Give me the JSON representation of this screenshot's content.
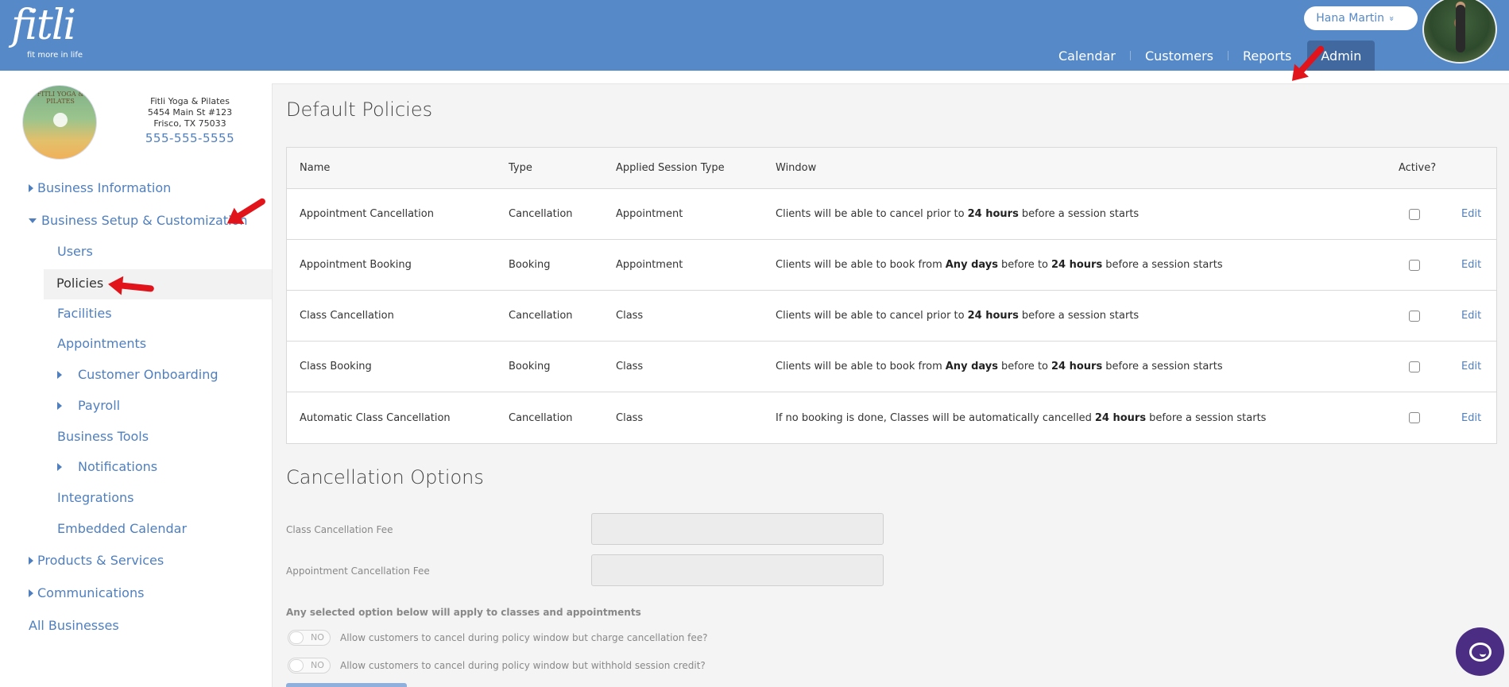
{
  "header": {
    "logo_word": "fitli",
    "logo_tagline": "fit more in life",
    "user_name": "Hana Martin",
    "user_chevron": "»",
    "nav": [
      "Calendar",
      "Customers",
      "Reports",
      "Admin"
    ],
    "active_nav": "Admin"
  },
  "sidebar": {
    "biz_logo_text": "FITLI YOGA & PILATES",
    "biz_name": "Fitli Yoga & Pilates",
    "biz_address1": "5454 Main St #123",
    "biz_address2": "Frisco, TX 75033",
    "biz_phone": "555-555-5555",
    "items": {
      "business_information": "Business Information",
      "business_setup": "Business Setup & Customization",
      "users": "Users",
      "policies": "Policies",
      "facilities": "Facilities",
      "appointments": "Appointments",
      "customer_onboarding": "Customer Onboarding",
      "payroll": "Payroll",
      "business_tools": "Business Tools",
      "notifications": "Notifications",
      "integrations": "Integrations",
      "embedded_calendar": "Embedded Calendar",
      "products_services": "Products & Services",
      "communications": "Communications",
      "all_businesses": "All Businesses"
    }
  },
  "main": {
    "default_policies_title": "Default Policies",
    "table": {
      "headers": {
        "name": "Name",
        "type": "Type",
        "session": "Applied Session Type",
        "window": "Window",
        "active": "Active?"
      },
      "rows": [
        {
          "name": "Appointment Cancellation",
          "type": "Cancellation",
          "session": "Appointment",
          "w1": "Clients will be able to cancel prior to",
          "b1": "24 hours",
          "w2": "before a session starts",
          "b2": "",
          "w3": "",
          "edit": "Edit"
        },
        {
          "name": "Appointment Booking",
          "type": "Booking",
          "session": "Appointment",
          "w1": "Clients will be able to book from",
          "b1": "Any days",
          "w2": "before to",
          "b2": "24 hours",
          "w3": "before a session starts",
          "edit": "Edit"
        },
        {
          "name": "Class Cancellation",
          "type": "Cancellation",
          "session": "Class",
          "w1": "Clients will be able to cancel prior to",
          "b1": "24 hours",
          "w2": "before a session starts",
          "b2": "",
          "w3": "",
          "edit": "Edit"
        },
        {
          "name": "Class Booking",
          "type": "Booking",
          "session": "Class",
          "w1": "Clients will be able to book from",
          "b1": "Any days",
          "w2": "before to",
          "b2": "24 hours",
          "w3": "before a session starts",
          "edit": "Edit"
        },
        {
          "name": "Automatic Class Cancellation",
          "type": "Cancellation",
          "session": "Class",
          "w1": "If no booking is done, Classes will be automatically cancelled",
          "b1": "24 hours",
          "w2": "before a session starts",
          "b2": "",
          "w3": "",
          "edit": "Edit"
        }
      ]
    },
    "cancellation_title": "Cancellation Options",
    "class_fee_label": "Class Cancellation Fee",
    "class_fee_value": "",
    "appt_fee_label": "Appointment Cancellation Fee",
    "appt_fee_value": "",
    "note": "Any selected option below will apply to classes and appointments",
    "toggles": [
      {
        "state": "NO",
        "label": "Allow customers to cancel during policy window but charge cancellation fee?"
      },
      {
        "state": "NO",
        "label": "Allow customers to cancel during policy window but withhold session credit?"
      }
    ]
  },
  "colors": {
    "header": "#5589c8",
    "active_nav": "#41699f",
    "link": "#4f7fbf",
    "chat": "#4b2e83",
    "annotation_arrow": "#e0141a"
  },
  "icons": [
    "chevron-down-icon",
    "caret-right-icon",
    "caret-down-icon",
    "checkbox-icon",
    "chat-icon",
    "annotation-arrow"
  ]
}
